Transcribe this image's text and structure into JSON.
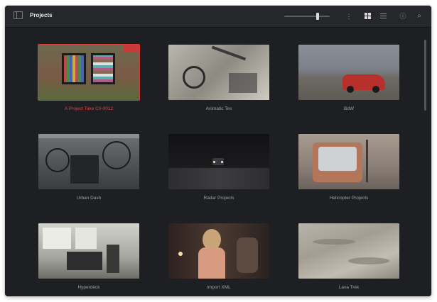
{
  "window": {
    "title": "Projects"
  },
  "projects": [
    {
      "name": "A Project Take C0-0012",
      "selected": true
    },
    {
      "name": "Animatic Tes",
      "selected": false
    },
    {
      "name": "BdW",
      "selected": false
    },
    {
      "name": "Urban Dash",
      "selected": false
    },
    {
      "name": "Radar Projects",
      "selected": false
    },
    {
      "name": "Helicopter Projects",
      "selected": false
    },
    {
      "name": "Hyperdeck",
      "selected": false
    },
    {
      "name": "Import XML",
      "selected": false
    },
    {
      "name": "Lava Trek",
      "selected": false
    }
  ],
  "colors": {
    "background": "#1e1f23",
    "titlebar": "#26272b",
    "selection": "#d63a3a"
  }
}
